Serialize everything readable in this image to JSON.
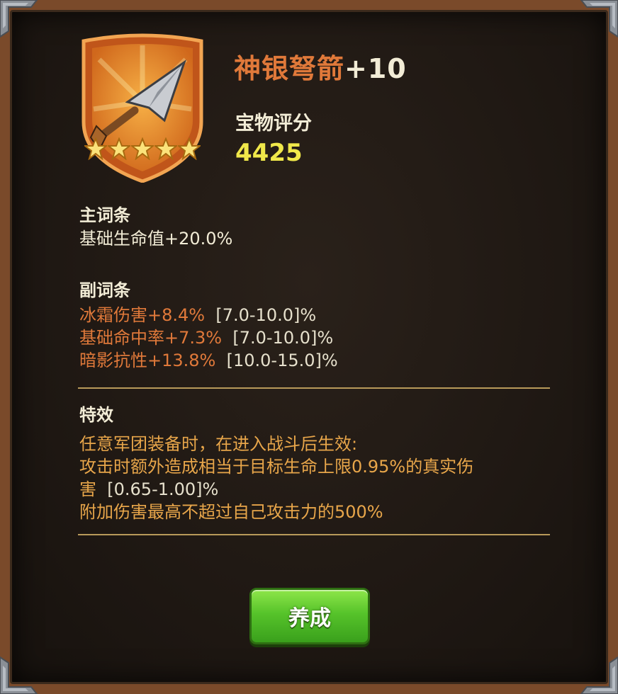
{
  "item": {
    "name": "神银弩箭",
    "level": "+10",
    "rating_label": "宝物评分",
    "rating_value": "4425",
    "stars": 5,
    "icon": "arrowhead-icon"
  },
  "main_stat": {
    "heading": "主词条",
    "line": "基础生命值+20.0%"
  },
  "sub_stats": {
    "heading": "副词条",
    "items": [
      {
        "stat": "冰霜伤害+8.4%",
        "range": "[7.0-10.0]%"
      },
      {
        "stat": "基础命中率+7.3%",
        "range": "[7.0-10.0]%"
      },
      {
        "stat": "暗影抗性+13.8%",
        "range": "[10.0-15.0]%"
      }
    ]
  },
  "effect": {
    "heading": "特效",
    "line1": "任意军团装备时，在进入战斗后生效:",
    "line2": "攻击时额外造成相当于目标生命上限0.95%的真实伤",
    "line3a": "害",
    "line3b": "[0.65-1.00]%",
    "line4": "附加伤害最高不超过自己攻击力的500%"
  },
  "button": {
    "label": "养成"
  },
  "colors": {
    "name_orange": "#e0793a",
    "score_yellow": "#f0e84a",
    "effect_gold": "#e8a64a",
    "button_green": "#56c32a"
  }
}
